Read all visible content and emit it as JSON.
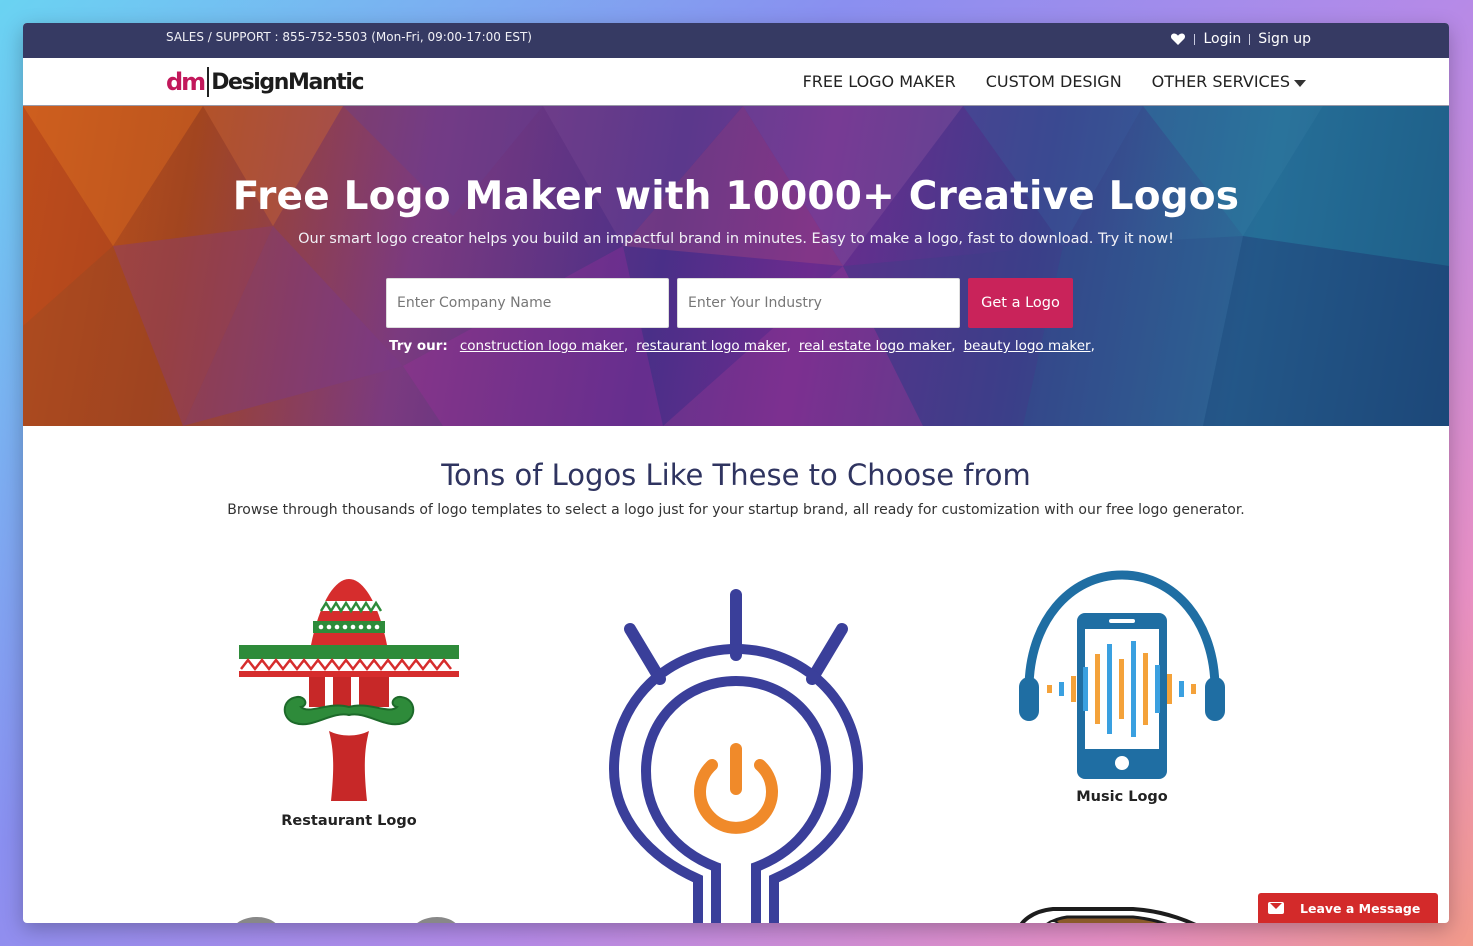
{
  "topbar": {
    "sales": "SALES / SUPPORT : 855-752-5503 (Mon-Fri, 09:00-17:00 EST)",
    "login": "Login",
    "signup": "Sign up"
  },
  "brand": {
    "mark": "dm",
    "name": "DesignMantic"
  },
  "nav": {
    "free_logo_maker": "FREE LOGO MAKER",
    "custom_design": "CUSTOM DESIGN",
    "other_services": "OTHER SERVICES"
  },
  "hero": {
    "title": "Free Logo Maker with 10000+ Creative Logos",
    "subtitle": "Our smart logo creator helps you build an impactful brand in minutes. Easy to make a logo, fast to download. Try it now!",
    "company_placeholder": "Enter Company Name",
    "industry_placeholder": "Enter Your Industry",
    "cta": "Get a Logo",
    "try_label": "Try our:",
    "try_links": [
      "construction logo maker",
      "restaurant logo maker",
      "real estate logo maker",
      "beauty logo maker"
    ]
  },
  "section": {
    "title": "Tons of Logos Like These to Choose from",
    "subtitle": "Browse through thousands of logo templates to select a logo just for your startup brand, all ready for customization with our free logo generator."
  },
  "gallery": {
    "items": [
      {
        "caption": "Restaurant Logo",
        "icon": "sombrero-mustache-icon"
      },
      {
        "caption": "",
        "icon": "lightbulb-power-icon"
      },
      {
        "caption": "Music Logo",
        "icon": "phone-headphones-icon"
      }
    ]
  },
  "chat": {
    "label": "Leave a Message"
  },
  "colors": {
    "topbar": "#363a63",
    "cta": "#c9235a",
    "heading": "#2f3460",
    "brand_pink": "#c2185b",
    "chat": "#d32a2a"
  }
}
